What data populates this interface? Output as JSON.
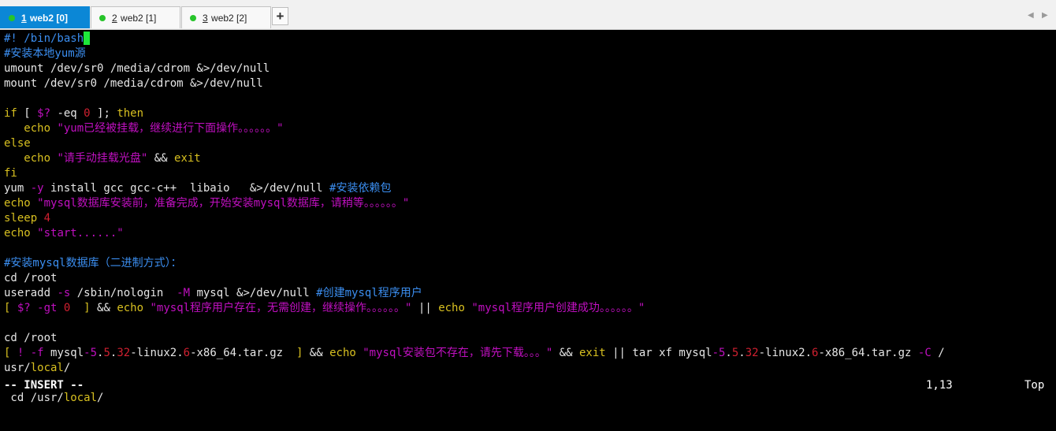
{
  "tabs": [
    {
      "num": "1",
      "label": "web2 [0]",
      "active": true
    },
    {
      "num": "2",
      "label": "web2 [1]",
      "active": false
    },
    {
      "num": "3",
      "label": "web2 [2]",
      "active": false
    }
  ],
  "new_tab_label": "+",
  "scroll_left_icon": "◀",
  "scroll_right_icon": "▶",
  "colors": {
    "tab_active": "#0b87d6",
    "session_dot": "#27c42a",
    "cursor": "#1ee83a",
    "background": "#000000"
  },
  "editor": {
    "lines": [
      [
        {
          "t": "#! /bin/bash",
          "c": "b"
        }
      ],
      [
        {
          "t": "#安装本地yum源",
          "c": "b"
        }
      ],
      [
        {
          "t": "umount /dev/sr0 /media/cdrom &>/dev/null",
          "c": "w"
        }
      ],
      [
        {
          "t": "mount /dev/sr0 /media/cdrom &>/dev/null",
          "c": "w"
        }
      ],
      [],
      [
        {
          "t": "if",
          "c": "y"
        },
        {
          "t": " [ ",
          "c": "w"
        },
        {
          "t": "$?",
          "c": "m"
        },
        {
          "t": " -eq ",
          "c": "w"
        },
        {
          "t": "0",
          "c": "r"
        },
        {
          "t": " ]; ",
          "c": "w"
        },
        {
          "t": "then",
          "c": "y"
        }
      ],
      [
        {
          "t": "   echo ",
          "c": "y"
        },
        {
          "t": "\"yum已经被挂载，继续进行下面操作。。。。。。\"",
          "c": "m"
        }
      ],
      [
        {
          "t": "else",
          "c": "y"
        }
      ],
      [
        {
          "t": "   echo ",
          "c": "y"
        },
        {
          "t": "\"请手动挂载光盘\"",
          "c": "m"
        },
        {
          "t": " && ",
          "c": "w"
        },
        {
          "t": "exit",
          "c": "y"
        }
      ],
      [
        {
          "t": "fi",
          "c": "y"
        }
      ],
      [
        {
          "t": "yum ",
          "c": "w"
        },
        {
          "t": "-y",
          "c": "m"
        },
        {
          "t": " install gcc gcc-c++  libaio   &>/dev/null ",
          "c": "w"
        },
        {
          "t": "#安装依赖包",
          "c": "b"
        }
      ],
      [
        {
          "t": "echo ",
          "c": "y"
        },
        {
          "t": "\"mysql数据库安装前，准备完成，开始安装mysql数据库，请稍等。。。。。。\"",
          "c": "m"
        }
      ],
      [
        {
          "t": "sleep ",
          "c": "y"
        },
        {
          "t": "4",
          "c": "r"
        }
      ],
      [
        {
          "t": "echo ",
          "c": "y"
        },
        {
          "t": "\"start......\"",
          "c": "m"
        }
      ],
      [],
      [
        {
          "t": "#安装mysql数据库（二进制方式）：",
          "c": "b"
        }
      ],
      [
        {
          "t": "cd /root",
          "c": "w"
        }
      ],
      [
        {
          "t": "useradd ",
          "c": "w"
        },
        {
          "t": "-s",
          "c": "m"
        },
        {
          "t": " /sbin/nologin  ",
          "c": "w"
        },
        {
          "t": "-M",
          "c": "m"
        },
        {
          "t": " mysql &>/dev/null ",
          "c": "w"
        },
        {
          "t": "#创建mysql程序用户",
          "c": "b"
        }
      ],
      [
        {
          "t": "[ ",
          "c": "y"
        },
        {
          "t": "$?",
          "c": "m"
        },
        {
          "t": " -gt ",
          "c": "m"
        },
        {
          "t": "0",
          "c": "r"
        },
        {
          "t": "  ] ",
          "c": "y"
        },
        {
          "t": "&& ",
          "c": "w"
        },
        {
          "t": "echo ",
          "c": "y"
        },
        {
          "t": "\"mysql程序用户存在，无需创建，继续操作。。。。。。\"",
          "c": "m"
        },
        {
          "t": " || ",
          "c": "w"
        },
        {
          "t": "echo ",
          "c": "y"
        },
        {
          "t": "\"mysql程序用户创建成功。。。。。。\"",
          "c": "m"
        }
      ],
      [],
      [
        {
          "t": "cd /root",
          "c": "w"
        }
      ],
      [
        {
          "t": "[ ",
          "c": "y"
        },
        {
          "t": "! -f ",
          "c": "m"
        },
        {
          "t": "mysql",
          "c": "w"
        },
        {
          "t": "-5",
          "c": "m"
        },
        {
          "t": ".",
          "c": "w"
        },
        {
          "t": "5",
          "c": "r"
        },
        {
          "t": ".",
          "c": "w"
        },
        {
          "t": "32",
          "c": "r"
        },
        {
          "t": "-linux2.",
          "c": "w"
        },
        {
          "t": "6",
          "c": "r"
        },
        {
          "t": "-x86_64.tar.gz  ",
          "c": "w"
        },
        {
          "t": "] ",
          "c": "y"
        },
        {
          "t": "&& ",
          "c": "w"
        },
        {
          "t": "echo ",
          "c": "y"
        },
        {
          "t": "\"mysql安装包不存在，请先下载。。。\"",
          "c": "m"
        },
        {
          "t": " && ",
          "c": "w"
        },
        {
          "t": "exit",
          "c": "y"
        },
        {
          "t": " || tar xf mysql",
          "c": "w"
        },
        {
          "t": "-5",
          "c": "m"
        },
        {
          "t": ".",
          "c": "w"
        },
        {
          "t": "5",
          "c": "r"
        },
        {
          "t": ".",
          "c": "w"
        },
        {
          "t": "32",
          "c": "r"
        },
        {
          "t": "-linux2.",
          "c": "w"
        },
        {
          "t": "6",
          "c": "r"
        },
        {
          "t": "-x86_64.tar.gz ",
          "c": "w"
        },
        {
          "t": "-C",
          "c": "m"
        },
        {
          "t": " /",
          "c": "w"
        }
      ],
      [
        {
          "t": "usr/",
          "c": "w"
        },
        {
          "t": "local",
          "c": "y"
        },
        {
          "t": "/",
          "c": "w"
        }
      ],
      [],
      [
        {
          "t": " cd /usr/",
          "c": "w"
        },
        {
          "t": "local",
          "c": "y"
        },
        {
          "t": "/",
          "c": "w"
        }
      ]
    ]
  },
  "status": {
    "mode": "-- INSERT --",
    "position": "1,13",
    "scroll": "Top"
  }
}
